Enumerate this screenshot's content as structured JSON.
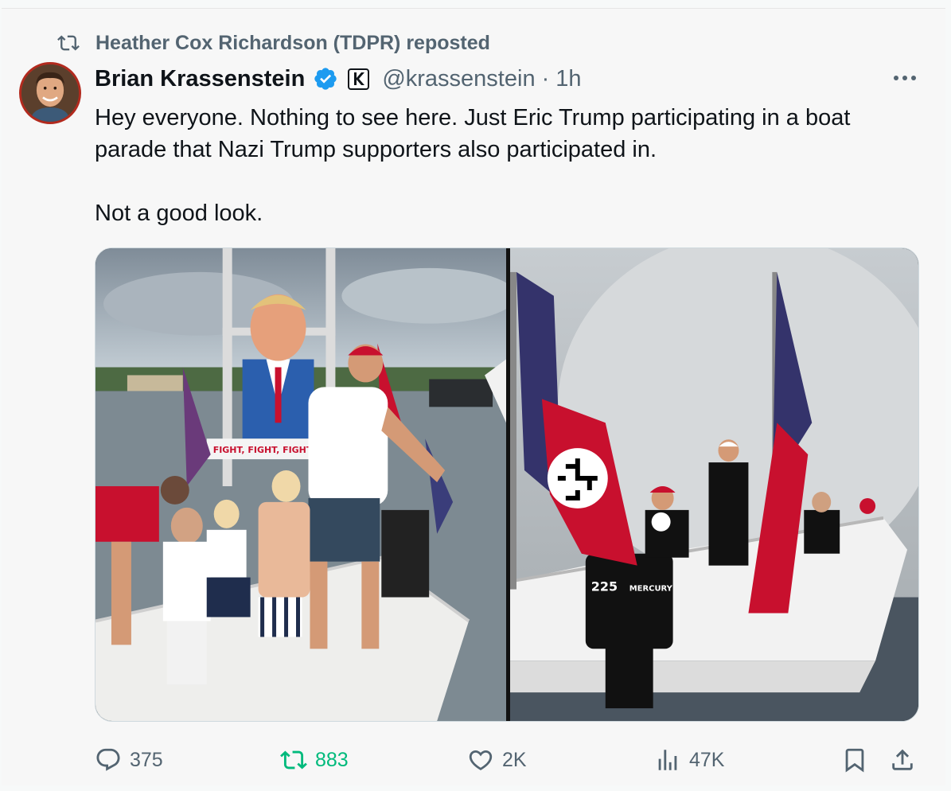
{
  "repost_banner": {
    "text": "Heather Cox Richardson (TDPR) reposted"
  },
  "author": {
    "name": "Brian Krassenstein",
    "handle": "@krassenstein",
    "separator": "·",
    "time": "1h",
    "badge_letter": "K"
  },
  "tweet": {
    "line1": "Hey everyone. Nothing to see here. Just Eric Trump participating in a boat parade that  Nazi Trump supporters also participated in.",
    "line2": "Not a good look."
  },
  "media": {
    "left_photo": {
      "signage": "FIGHT, FIGHT, FIGHT"
    },
    "right_photo": {
      "engine_label": "225",
      "engine_brand": "MERCURY"
    }
  },
  "actions": {
    "replies": "375",
    "reposts": "883",
    "likes": "2K",
    "views": "47K"
  },
  "colors": {
    "repost_active": "#00ba7c",
    "verified": "#1d9bf0",
    "secondary_text": "#536471"
  }
}
